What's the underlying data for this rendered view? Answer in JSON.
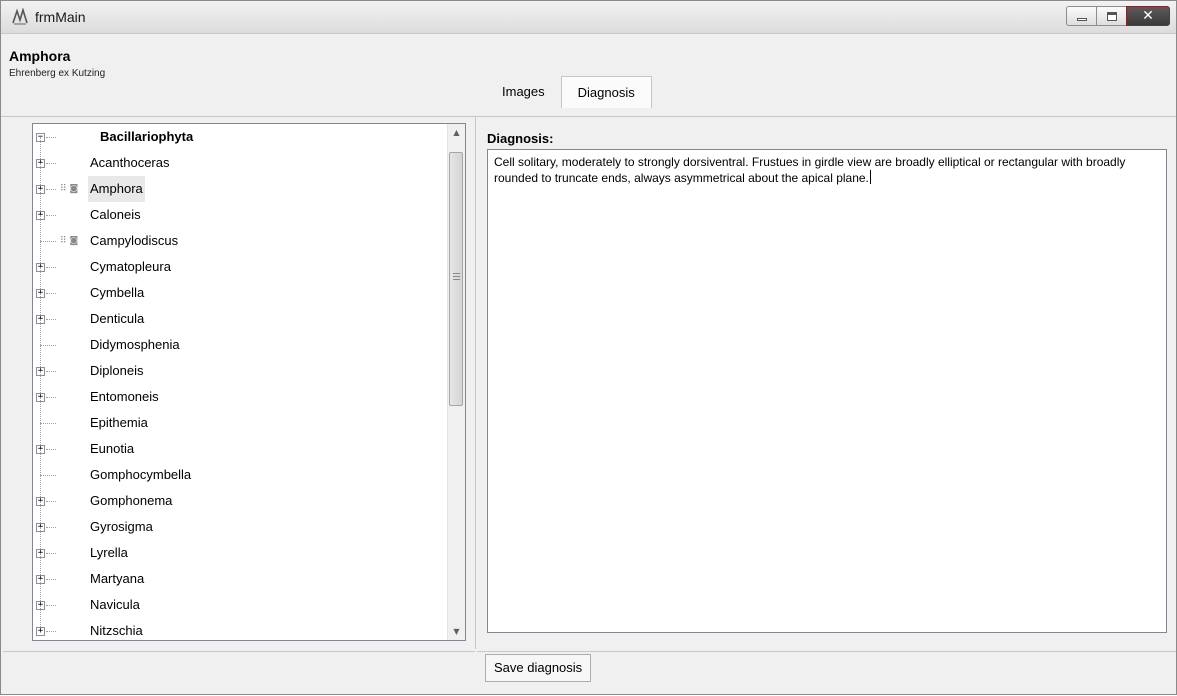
{
  "window": {
    "title": "frmMain"
  },
  "header": {
    "genus": "Amphora",
    "author": "Ehrenberg ex Kutzing",
    "tabs": [
      {
        "label": "Images",
        "active": false
      },
      {
        "label": "Diagnosis",
        "active": true
      }
    ]
  },
  "tree": {
    "root": "Bacillariophyta",
    "items": [
      {
        "label": "Acanthoceras",
        "expandable": true,
        "icons": false,
        "selected": false
      },
      {
        "label": "Amphora",
        "expandable": true,
        "icons": true,
        "selected": true
      },
      {
        "label": "Caloneis",
        "expandable": true,
        "icons": false,
        "selected": false
      },
      {
        "label": "Campylodiscus",
        "expandable": false,
        "icons": true,
        "selected": false
      },
      {
        "label": "Cymatopleura",
        "expandable": true,
        "icons": false,
        "selected": false
      },
      {
        "label": "Cymbella",
        "expandable": true,
        "icons": false,
        "selected": false
      },
      {
        "label": "Denticula",
        "expandable": true,
        "icons": false,
        "selected": false
      },
      {
        "label": "Didymosphenia",
        "expandable": false,
        "icons": false,
        "selected": false
      },
      {
        "label": "Diploneis",
        "expandable": true,
        "icons": false,
        "selected": false
      },
      {
        "label": "Entomoneis",
        "expandable": true,
        "icons": false,
        "selected": false
      },
      {
        "label": "Epithemia",
        "expandable": false,
        "icons": false,
        "selected": false
      },
      {
        "label": "Eunotia",
        "expandable": true,
        "icons": false,
        "selected": false
      },
      {
        "label": "Gomphocymbella",
        "expandable": false,
        "icons": false,
        "selected": false
      },
      {
        "label": "Gomphonema",
        "expandable": true,
        "icons": false,
        "selected": false
      },
      {
        "label": "Gyrosigma",
        "expandable": true,
        "icons": false,
        "selected": false
      },
      {
        "label": "Lyrella",
        "expandable": true,
        "icons": false,
        "selected": false
      },
      {
        "label": "Martyana",
        "expandable": true,
        "icons": false,
        "selected": false
      },
      {
        "label": "Navicula",
        "expandable": true,
        "icons": false,
        "selected": false
      },
      {
        "label": "Nitzschia",
        "expandable": true,
        "icons": false,
        "selected": false
      }
    ]
  },
  "diagnosis": {
    "label": "Diagnosis:",
    "text": "Cell solitary, moderately to strongly dorsiventral. Frustues in girdle view are broadly elliptical or rectangular with broadly rounded to truncate ends, always asymmetrical about the apical plane."
  },
  "save_button": "Save diagnosis"
}
